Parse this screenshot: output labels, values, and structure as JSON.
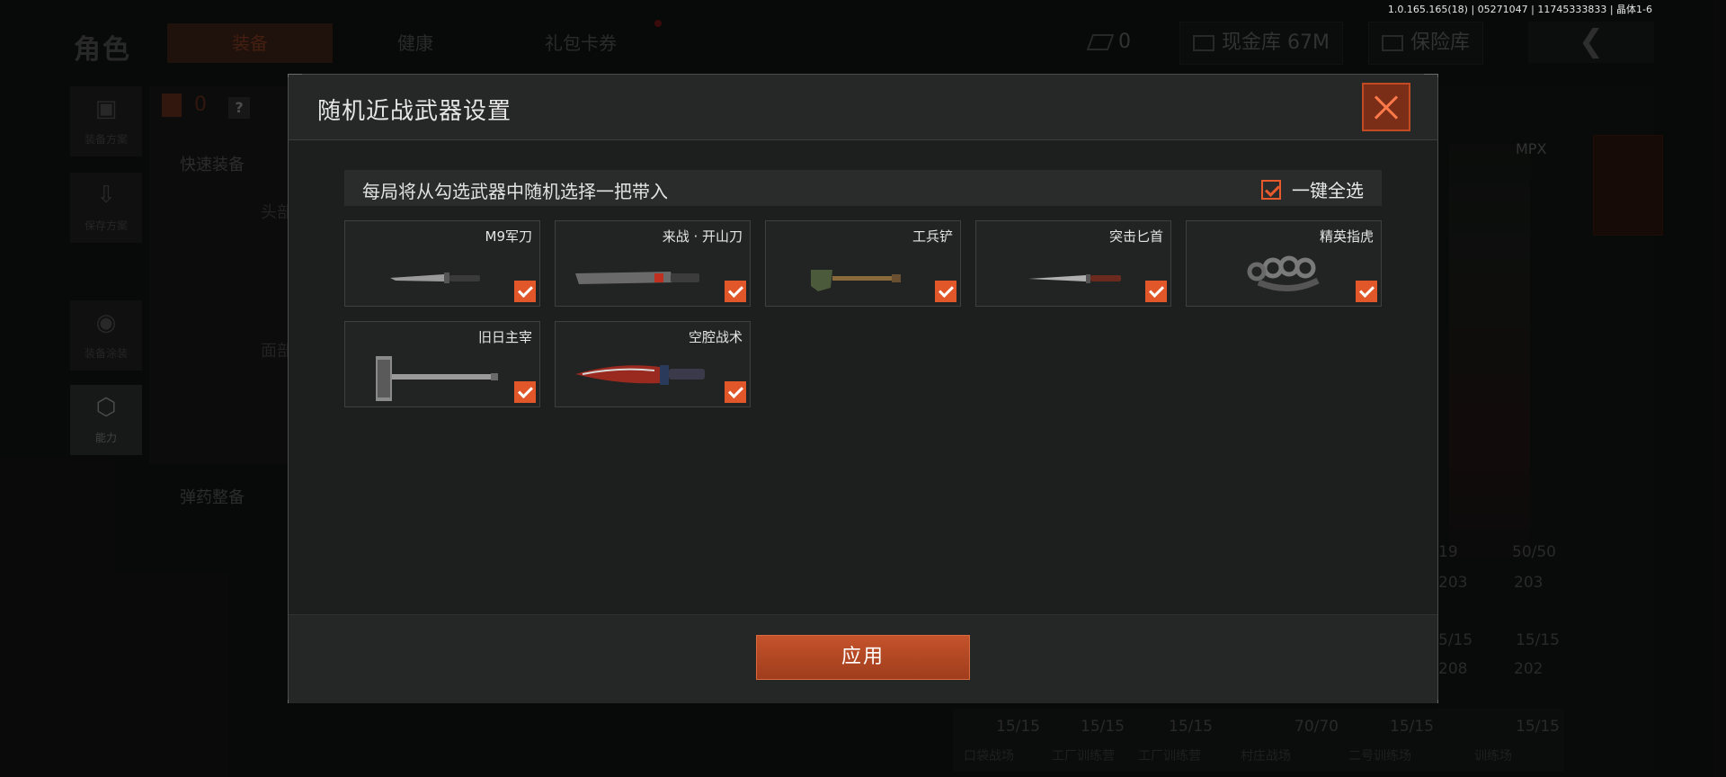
{
  "version": "1.0.165.165(18) | 05271047 | 11745333833 | 晶体1-6",
  "background": {
    "title": "角色",
    "tabs": [
      {
        "label": "装备",
        "active": true
      },
      {
        "label": "健康",
        "active": false
      },
      {
        "label": "礼包卡券",
        "active": false
      }
    ],
    "tickets": "0",
    "cash_vault": "现金库 67M",
    "insurance_vault": "保险库",
    "left_menu": [
      {
        "label": "装备方案",
        "icon": "vest-icon"
      },
      {
        "label": "保存方案",
        "icon": "save-icon"
      },
      {
        "label": "装备涂装",
        "icon": "helmet-icon"
      },
      {
        "label": "能力",
        "icon": "ability-icon"
      }
    ],
    "quick_equip": "快速装备",
    "ammo_equip": "弹药整备",
    "vest_count": "0",
    "help": "?",
    "slot_head": "头部",
    "slot_face": "面部",
    "weapon_name": "MPX",
    "ammo_counts": [
      "19",
      "50/50",
      "203",
      "203",
      "5/15",
      "15/15",
      "208",
      "202"
    ],
    "bottom_slots": [
      {
        "count": "15/15",
        "name": "口袋战场"
      },
      {
        "count": "15/15",
        "name": "工厂训练营"
      },
      {
        "count": "15/15",
        "name": "工厂训练营"
      },
      {
        "count": "70/70",
        "name": "村庄战场"
      },
      {
        "count": "15/15",
        "name": "二号训练场"
      },
      {
        "count": "15/15",
        "name": "训练场"
      }
    ]
  },
  "dialog": {
    "title": "随机近战武器设置",
    "description": "每局将从勾选武器中随机选择一把带入",
    "select_all_label": "一键全选",
    "select_all_checked": true,
    "apply_label": "应用",
    "weapons": [
      {
        "name": "M9军刀",
        "checked": true,
        "art": "bayonet"
      },
      {
        "name": "来战 · 开山刀",
        "checked": true,
        "art": "machete"
      },
      {
        "name": "工兵铲",
        "checked": true,
        "art": "shovel"
      },
      {
        "name": "突击匕首",
        "checked": true,
        "art": "dagger"
      },
      {
        "name": "精英指虎",
        "checked": true,
        "art": "knuckles"
      },
      {
        "name": "旧日主宰",
        "checked": true,
        "art": "hammer"
      },
      {
        "name": "空腔战术",
        "checked": true,
        "art": "tactical"
      }
    ]
  },
  "colors": {
    "accent": "#e2572a",
    "apply_button": "#b24724",
    "dialog_bg": "#1d1e1e"
  }
}
